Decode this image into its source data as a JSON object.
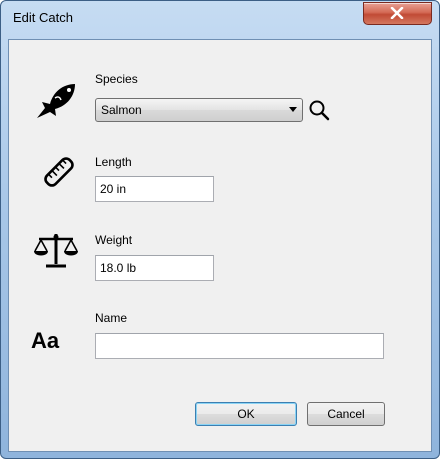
{
  "window": {
    "title": "Edit Catch"
  },
  "species": {
    "label": "Species",
    "selected": "Salmon"
  },
  "length": {
    "label": "Length",
    "value": "20 in"
  },
  "weight": {
    "label": "Weight",
    "value": "18.0 lb"
  },
  "name": {
    "label": "Name",
    "value": "",
    "icon_text": "Aa"
  },
  "buttons": {
    "ok": "OK",
    "cancel": "Cancel"
  },
  "icons": {
    "species": "fish-icon",
    "length": "ruler-icon",
    "weight": "scale-icon",
    "search": "search-icon",
    "close": "close-icon"
  }
}
